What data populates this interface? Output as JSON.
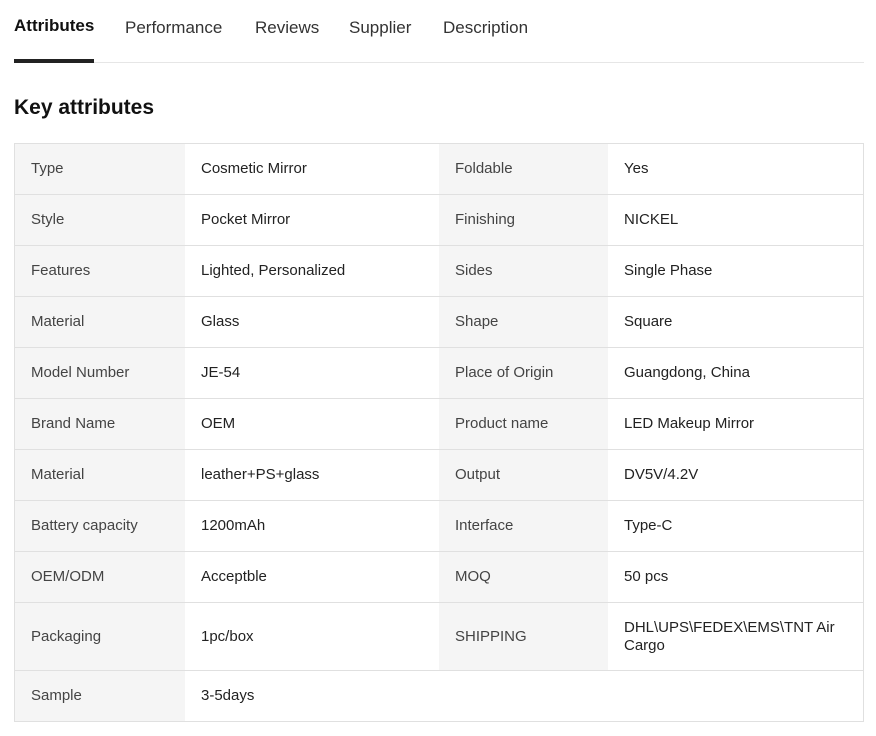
{
  "tabs": [
    {
      "label": "Attributes",
      "active": true
    },
    {
      "label": "Performance",
      "active": false
    },
    {
      "label": "Reviews",
      "active": false
    },
    {
      "label": "Supplier",
      "active": false
    },
    {
      "label": "Description",
      "active": false
    }
  ],
  "section_title": "Key attributes",
  "rows": [
    {
      "k1": "Type",
      "v1": "Cosmetic Mirror",
      "k2": "Foldable",
      "v2": "Yes"
    },
    {
      "k1": "Style",
      "v1": "Pocket Mirror",
      "k2": "Finishing",
      "v2": "NICKEL"
    },
    {
      "k1": "Features",
      "v1": "Lighted, Personalized",
      "k2": "Sides",
      "v2": "Single Phase"
    },
    {
      "k1": "Material",
      "v1": "Glass",
      "k2": "Shape",
      "v2": "Square"
    },
    {
      "k1": "Model Number",
      "v1": "JE-54",
      "k2": "Place of Origin",
      "v2": "Guangdong, China"
    },
    {
      "k1": "Brand Name",
      "v1": "OEM",
      "k2": "Product name",
      "v2": "LED Makeup Mirror"
    },
    {
      "k1": "Material",
      "v1": "leather+PS+glass",
      "k2": "Output",
      "v2": "DV5V/4.2V"
    },
    {
      "k1": "Battery capacity",
      "v1": "1200mAh",
      "k2": "Interface",
      "v2": "Type-C"
    },
    {
      "k1": "OEM/ODM",
      "v1": "Acceptble",
      "k2": "MOQ",
      "v2": "50 pcs"
    },
    {
      "k1": "Packaging",
      "v1": "1pc/box",
      "k2": "SHIPPING",
      "v2": "DHL\\UPS\\FEDEX\\EMS\\TNT Air Cargo"
    },
    {
      "k1": "Sample",
      "v1": "3-5days",
      "k2": "",
      "v2": ""
    }
  ]
}
